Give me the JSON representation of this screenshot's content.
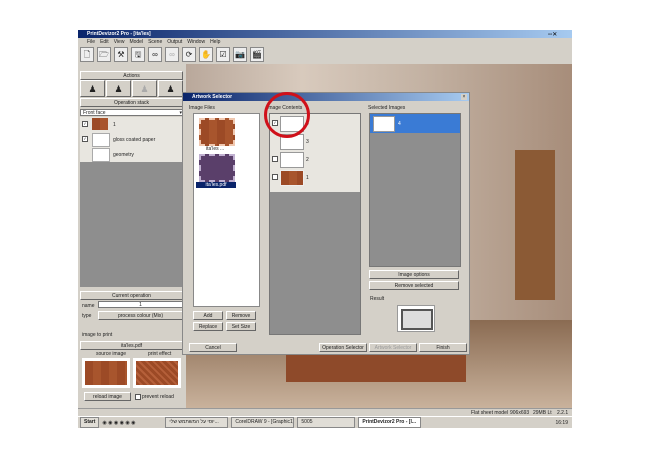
{
  "app": {
    "title": "PrintDevizor2 Pro - [ita'les]",
    "menu": [
      "File",
      "Edit",
      "View",
      "Model",
      "Scene",
      "Output",
      "Window",
      "Help"
    ],
    "toolbar_icons": [
      "new-icon",
      "open-icon",
      "tools-icon",
      "save-icon",
      "link-icon",
      "unlink-icon",
      "camera-rotate-icon",
      "hand-icon",
      "check-icon",
      "camera-icon",
      "film-icon"
    ]
  },
  "left": {
    "actions_label": "Actions",
    "operation_stack_label": "Operation stack",
    "face_select": "Front face",
    "stack": [
      {
        "label": "1",
        "checked": true
      },
      {
        "label": "gloss coated paper",
        "checked": true
      },
      {
        "label": "geometry",
        "checked": false
      }
    ],
    "current_operation_label": "Current operation",
    "name_label": "name",
    "name_value": "1",
    "type_label": "type",
    "type_value": "process colour (Mix)",
    "image_to_print_label": "image to print",
    "image_file": "ita'les.pdf",
    "source_image_label": "source image",
    "print_effect_label": "print effect",
    "reload_image": "reload image",
    "prevent_reload": "prevent reload"
  },
  "dialog": {
    "title": "Artwork Selector",
    "image_files_label": "Image Files",
    "files": [
      {
        "name": "ita'les ..."
      },
      {
        "name": "ita'les.pdf",
        "selected": true
      }
    ],
    "image_contents_label": "Image Contents",
    "contents": [
      {
        "n": "4",
        "checked": true
      },
      {
        "n": "3",
        "checked": false
      },
      {
        "n": "2",
        "checked": false
      },
      {
        "n": "1",
        "checked": false
      }
    ],
    "selected_images_label": "Selected Images",
    "selected": [
      {
        "n": "4"
      }
    ],
    "image_options": "Image options",
    "remove_selected": "Remove selected",
    "result_label": "Result",
    "add": "Add",
    "remove": "Remove",
    "replace": "Replace",
    "set_size": "Set Size",
    "cancel": "Cancel",
    "operation_selector": "Operation Selector",
    "artwork_selector": "Artwork Selector",
    "finish": "Finish",
    "highlight_color": "#d0101a"
  },
  "status": {
    "mode": "Flat sheet model",
    "resolution": "906x693",
    "memory": "29MB Lt",
    "version": "2.2.1"
  },
  "taskbar": {
    "start": "Start",
    "tasks": [
      "יוסי על המשתמש שלי...",
      "CorelDRAW 9 - [Graphic1]",
      "5005",
      "PrintDevizor2 Pro - [I..."
    ],
    "clock": "16:19"
  }
}
